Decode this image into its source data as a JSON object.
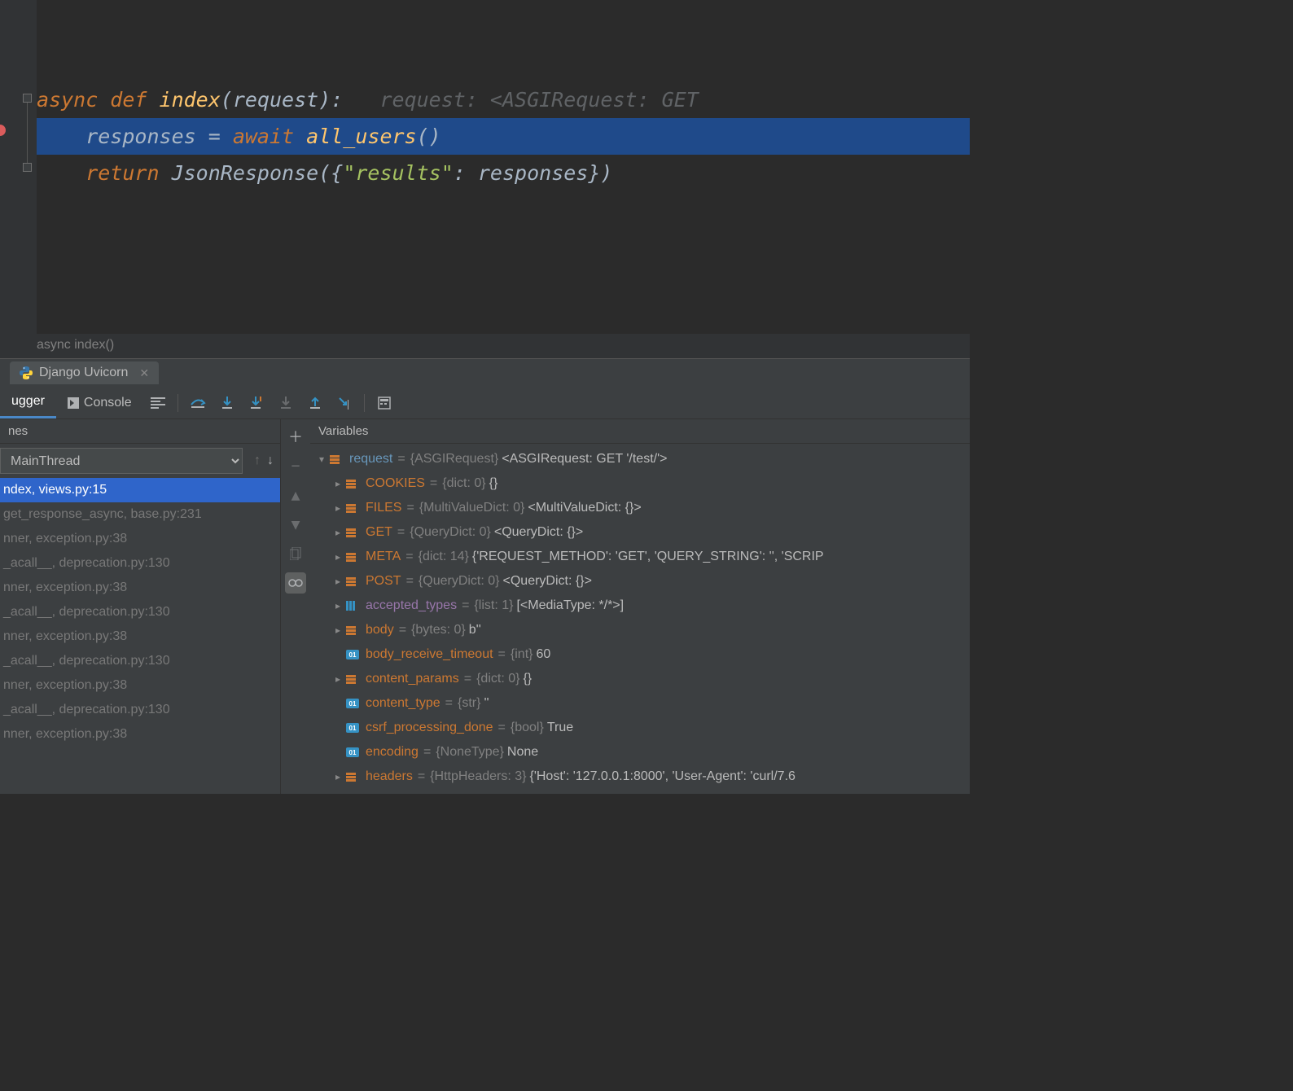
{
  "editor": {
    "breadcrumb": "async index()",
    "lines": [
      {
        "tokens": [
          {
            "t": "async def ",
            "c": "kw"
          },
          {
            "t": "index",
            "c": "fn"
          },
          {
            "t": "(",
            "c": "normal"
          },
          {
            "t": "request",
            "c": "param"
          },
          {
            "t": "):",
            "c": "normal"
          },
          {
            "t": "   request: <ASGIRequest: GET",
            "c": "hint"
          }
        ]
      },
      {
        "highlight": true,
        "breakpoint": true,
        "tokens": [
          {
            "t": "    responses ",
            "c": "normal"
          },
          {
            "t": "= ",
            "c": "normal"
          },
          {
            "t": "await ",
            "c": "kw"
          },
          {
            "t": "all_users",
            "c": "fn"
          },
          {
            "t": "()",
            "c": "normal"
          }
        ]
      },
      {
        "tokens": [
          {
            "t": "    ",
            "c": "normal"
          },
          {
            "t": "return ",
            "c": "kw"
          },
          {
            "t": "JsonResponse",
            "c": "normal"
          },
          {
            "t": "({",
            "c": "normal"
          },
          {
            "t": "\"results\"",
            "c": "str"
          },
          {
            "t": ": responses})",
            "c": "normal"
          }
        ]
      }
    ]
  },
  "run_tab": {
    "label": "Django Uvicorn"
  },
  "toolbar": {
    "debugger": "ugger",
    "console": "Console"
  },
  "frames": {
    "header": "nes",
    "thread": "MainThread",
    "stack": [
      {
        "label": "ndex, views.py:15",
        "selected": true
      },
      {
        "label": "get_response_async, base.py:231"
      },
      {
        "label": "nner, exception.py:38"
      },
      {
        "label": "_acall__, deprecation.py:130"
      },
      {
        "label": "nner, exception.py:38"
      },
      {
        "label": "_acall__, deprecation.py:130"
      },
      {
        "label": "nner, exception.py:38"
      },
      {
        "label": "_acall__, deprecation.py:130"
      },
      {
        "label": "nner, exception.py:38"
      },
      {
        "label": "_acall__, deprecation.py:130"
      },
      {
        "label": "nner, exception.py:38"
      }
    ]
  },
  "variables": {
    "header": "Variables",
    "root": {
      "name": "request",
      "type": "{ASGIRequest}",
      "val": "<ASGIRequest: GET '/test/'>"
    },
    "children": [
      {
        "icon": "grp",
        "arrow": true,
        "name": "COOKIES",
        "type": "{dict: 0}",
        "val": "{}"
      },
      {
        "icon": "grp",
        "arrow": true,
        "name": "FILES",
        "type": "{MultiValueDict: 0}",
        "val": "<MultiValueDict: {}>"
      },
      {
        "icon": "grp",
        "arrow": true,
        "name": "GET",
        "type": "{QueryDict: 0}",
        "val": "<QueryDict: {}>"
      },
      {
        "icon": "grp",
        "arrow": true,
        "name": "META",
        "type": "{dict: 14}",
        "val": "{'REQUEST_METHOD': 'GET', 'QUERY_STRING': '', 'SCRIP"
      },
      {
        "icon": "grp",
        "arrow": true,
        "name": "POST",
        "type": "{QueryDict: 0}",
        "val": "<QueryDict: {}>"
      },
      {
        "icon": "list",
        "arrow": true,
        "name": "accepted_types",
        "special": true,
        "type": "{list: 1}",
        "val": "[<MediaType: */*>]"
      },
      {
        "icon": "grp",
        "arrow": true,
        "name": "body",
        "type": "{bytes: 0}",
        "val": "b''"
      },
      {
        "icon": "prim",
        "arrow": false,
        "name": "body_receive_timeout",
        "type": "{int}",
        "val": "60"
      },
      {
        "icon": "grp",
        "arrow": true,
        "name": "content_params",
        "type": "{dict: 0}",
        "val": "{}"
      },
      {
        "icon": "prim",
        "arrow": false,
        "name": "content_type",
        "type": "{str}",
        "val": "''"
      },
      {
        "icon": "prim",
        "arrow": false,
        "name": "csrf_processing_done",
        "type": "{bool}",
        "val": "True"
      },
      {
        "icon": "prim",
        "arrow": false,
        "name": "encoding",
        "type": "{NoneType}",
        "val": "None"
      },
      {
        "icon": "grp",
        "arrow": true,
        "name": "headers",
        "type": "{HttpHeaders: 3}",
        "val": "{'Host': '127.0.0.1:8000', 'User-Agent': 'curl/7.6"
      }
    ]
  }
}
